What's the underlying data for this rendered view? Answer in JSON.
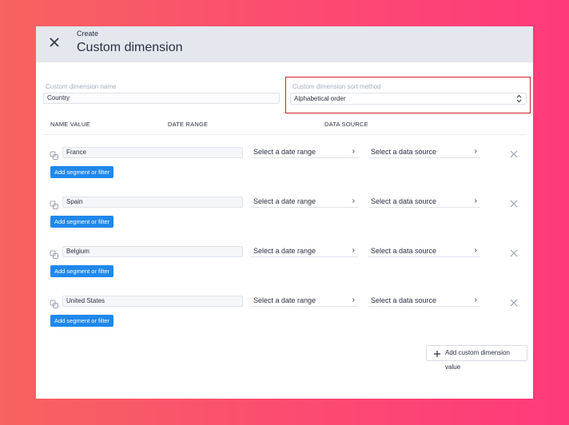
{
  "header": {
    "subtitle": "Create",
    "title": "Custom dimension"
  },
  "form": {
    "name_label": "Custom dimension name",
    "name_value": "Country",
    "sort_label": "Custom dimension sort method",
    "sort_value": "Alphabetical order"
  },
  "columns": {
    "name_value": "NAME VALUE",
    "date_range": "DATE RANGE",
    "data_source": "DATA SOURCE"
  },
  "rows": [
    {
      "value": "France",
      "date_range": "Select a date range",
      "data_source": "Select a data source",
      "segment_button": "Add segment or filter"
    },
    {
      "value": "Spain",
      "date_range": "Select a date range",
      "data_source": "Select a data source",
      "segment_button": "Add segment or filter"
    },
    {
      "value": "Belgium",
      "date_range": "Select a date range",
      "data_source": "Select a data source",
      "segment_button": "Add segment or filter"
    },
    {
      "value": "United States",
      "date_range": "Select a date range",
      "data_source": "Select a data source",
      "segment_button": "Add segment or filter"
    }
  ],
  "add_value_button": "Add custom dimension value",
  "colors": {
    "accent_blue": "#1f88ec",
    "highlight_red": "#d81e2c",
    "header_bg": "#e4e7ee"
  },
  "icons": {
    "close": "close-icon",
    "row": "link-icon",
    "chevron": "chevron-right-icon",
    "remove": "remove-x-icon",
    "sort": "sort-arrows-icon",
    "plus": "plus-icon"
  }
}
